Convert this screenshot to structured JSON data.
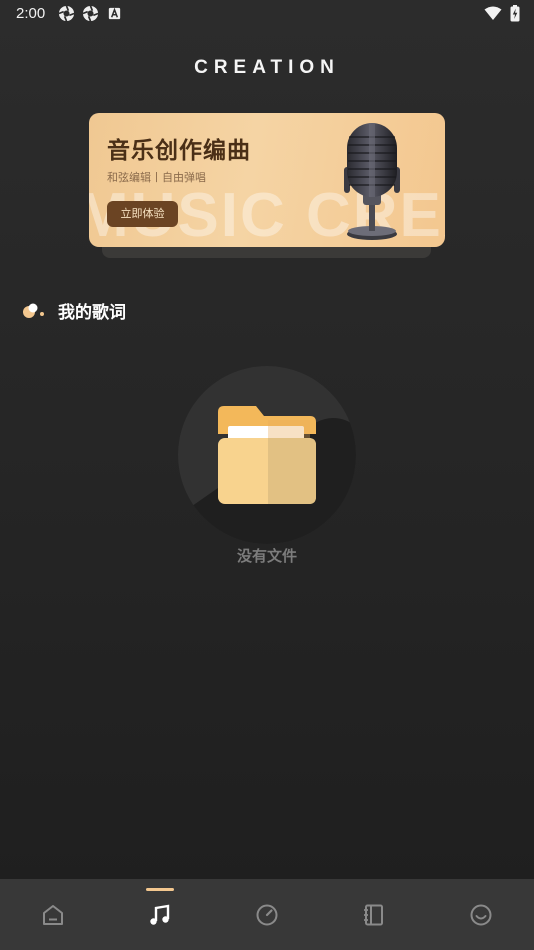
{
  "status_bar": {
    "time": "2:00",
    "left_icons": [
      "aperture-icon",
      "aperture-icon",
      "font-a-icon"
    ],
    "right_icons": [
      "wifi-icon",
      "battery-charging-icon"
    ]
  },
  "header": {
    "brand": "CREATION"
  },
  "banner": {
    "title": "音乐创作编曲",
    "subtitle": "和弦编辑丨自由弹唱",
    "button_label": "立即体验",
    "watermark": "MUSIC CREATIO",
    "icon": "microphone-image",
    "colors": {
      "bg": "#f3c78f",
      "button": "#6b4423",
      "title": "#4a2f17"
    }
  },
  "lyrics_section": {
    "title": "我的歌词",
    "icon": "dots-icon"
  },
  "empty_state": {
    "text": "没有文件",
    "icon": "folder-icon"
  },
  "bottom_nav": {
    "items": [
      {
        "name": "home",
        "icon": "home-icon"
      },
      {
        "name": "music",
        "icon": "music-note-icon",
        "active": true
      },
      {
        "name": "discover",
        "icon": "compass-icon"
      },
      {
        "name": "notebook",
        "icon": "notebook-icon"
      },
      {
        "name": "profile",
        "icon": "smile-icon"
      }
    ],
    "accent_color": "#f3c78f"
  }
}
